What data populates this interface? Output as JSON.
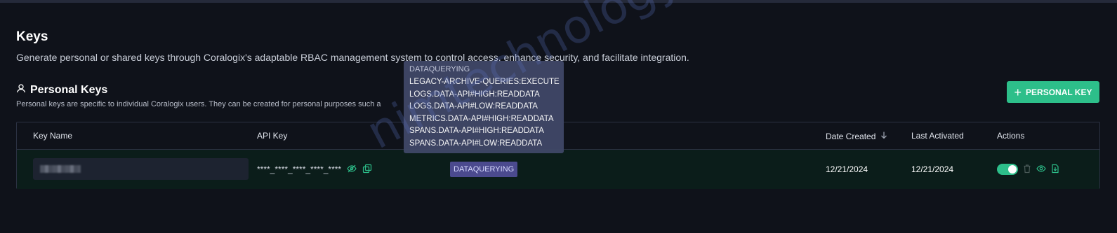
{
  "page": {
    "title": "Keys",
    "description": "Generate personal or shared keys through Coralogix's adaptable RBAC management system to control access, enhance security, and facilitate integration."
  },
  "section": {
    "title": "Personal Keys",
    "description": "Personal keys are specific to individual Coralogix users. They can be created for personal purposes such a",
    "add_button_label": "PERSONAL KEY"
  },
  "table": {
    "columns": {
      "key_name": "Key Name",
      "api_key": "API Key",
      "date_created": "Date Created",
      "last_activated": "Last Activated",
      "actions": "Actions"
    },
    "rows": [
      {
        "api_key_masked": "****_****_****_****_****",
        "preset_badge": "DATAQUERYING",
        "date_created": "12/21/2024",
        "last_activated": "12/21/2024",
        "active": true
      }
    ]
  },
  "tooltip": {
    "header": "DATAQUERYING",
    "lines": [
      "LEGACY-ARCHIVE-QUERIES:EXECUTE",
      "LOGS.DATA-API#HIGH:READDATA",
      "LOGS.DATA-API#LOW:READDATA",
      "METRICS.DATA-API#HIGH:READDATA",
      "SPANS.DATA-API#HIGH:READDATA",
      "SPANS.DATA-API#LOW:READDATA"
    ]
  },
  "watermark": "nimtechnology.com",
  "colors": {
    "background": "#0f121a",
    "accent": "#2dbf8a",
    "badge": "#4b4a8e",
    "tooltip": "#3f4766"
  },
  "icons": [
    "user-icon",
    "plus-icon",
    "eye-off-icon",
    "copy-icon",
    "sort-down-icon",
    "trash-icon",
    "eye-icon",
    "download-icon"
  ]
}
